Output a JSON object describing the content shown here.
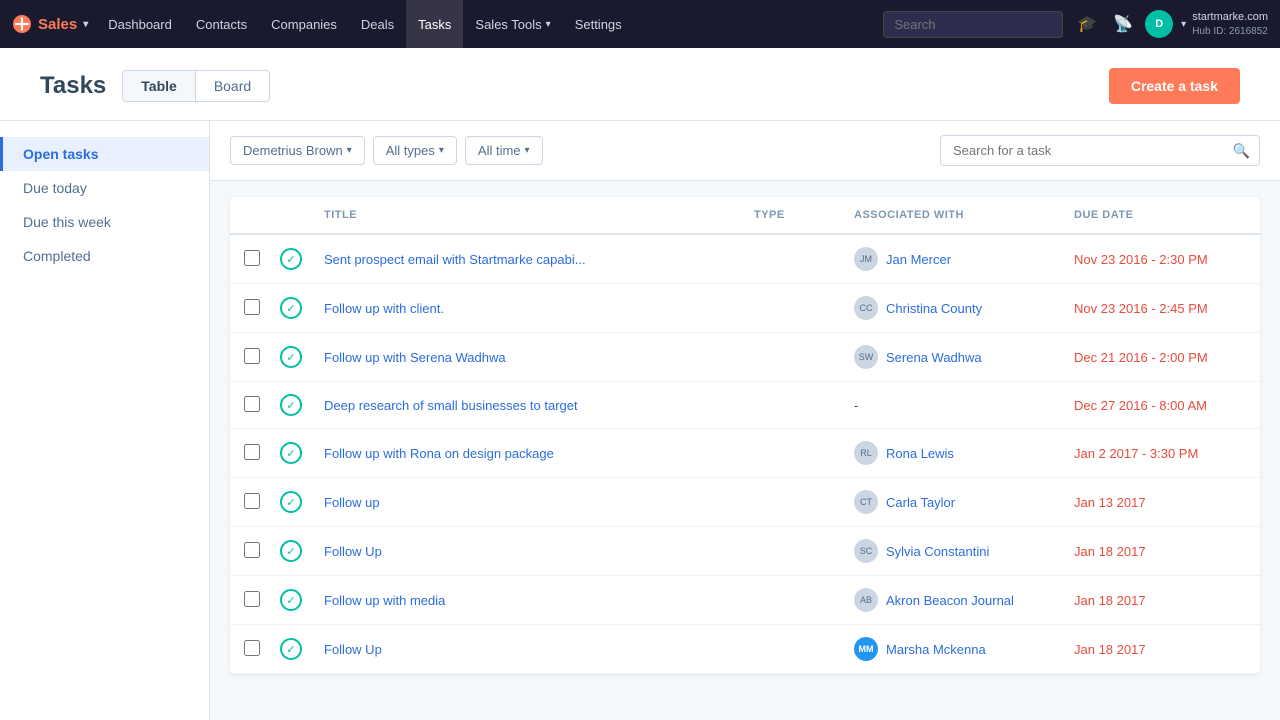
{
  "nav": {
    "brand": "Sales",
    "items": [
      {
        "label": "Dashboard",
        "active": false
      },
      {
        "label": "Contacts",
        "active": false
      },
      {
        "label": "Companies",
        "active": false
      },
      {
        "label": "Deals",
        "active": false
      },
      {
        "label": "Tasks",
        "active": true
      },
      {
        "label": "Sales Tools",
        "active": false,
        "hasChevron": true
      },
      {
        "label": "Settings",
        "active": false
      }
    ],
    "search_placeholder": "Search",
    "profile": {
      "site": "startmarke.com",
      "hub": "Hub ID: 2616852"
    }
  },
  "page": {
    "title": "Tasks",
    "view_tabs": [
      {
        "label": "Table",
        "active": true
      },
      {
        "label": "Board",
        "active": false
      }
    ],
    "create_task_label": "Create a task"
  },
  "sidebar": {
    "items": [
      {
        "label": "Open tasks",
        "active": true
      },
      {
        "label": "Due today",
        "active": false
      },
      {
        "label": "Due this week",
        "active": false
      },
      {
        "label": "Completed",
        "active": false
      }
    ]
  },
  "filters": {
    "owner": "Demetrius Brown",
    "type": "All types",
    "time": "All time",
    "search_placeholder": "Search for a task"
  },
  "table": {
    "columns": [
      "",
      "",
      "TITLE",
      "TYPE",
      "ASSOCIATED WITH",
      "DUE DATE"
    ],
    "rows": [
      {
        "title": "Sent prospect email with Startmarke capabi...",
        "type": "",
        "associated_name": "Jan Mercer",
        "associated_avatar": "JM",
        "due_date": "Nov 23 2016 - 2:30 PM"
      },
      {
        "title": "Follow up with client.",
        "type": "",
        "associated_name": "Christina County",
        "associated_avatar": "CC",
        "due_date": "Nov 23 2016 - 2:45 PM"
      },
      {
        "title": "Follow up with Serena Wadhwa",
        "type": "",
        "associated_name": "Serena Wadhwa",
        "associated_avatar": "SW",
        "due_date": "Dec 21 2016 - 2:00 PM"
      },
      {
        "title": "Deep research of small businesses to target",
        "type": "",
        "associated_name": "-",
        "associated_avatar": "",
        "due_date": "Dec 27 2016 - 8:00 AM"
      },
      {
        "title": "Follow up with Rona on design package",
        "type": "",
        "associated_name": "Rona Lewis",
        "associated_avatar": "RL",
        "due_date": "Jan 2 2017 - 3:30 PM"
      },
      {
        "title": "Follow up",
        "type": "",
        "associated_name": "Carla Taylor",
        "associated_avatar": "CT",
        "due_date": "Jan 13 2017"
      },
      {
        "title": "Follow Up",
        "type": "",
        "associated_name": "Sylvia Constantini",
        "associated_avatar": "SC",
        "due_date": "Jan 18 2017"
      },
      {
        "title": "Follow up with media",
        "type": "",
        "associated_name": "Akron Beacon Journal",
        "associated_avatar": "AB",
        "due_date": "Jan 18 2017"
      },
      {
        "title": "Follow Up",
        "type": "",
        "associated_name": "Marsha Mckenna",
        "associated_avatar": "MM",
        "due_date": "Jan 18 2017",
        "special_avatar": true
      }
    ]
  }
}
